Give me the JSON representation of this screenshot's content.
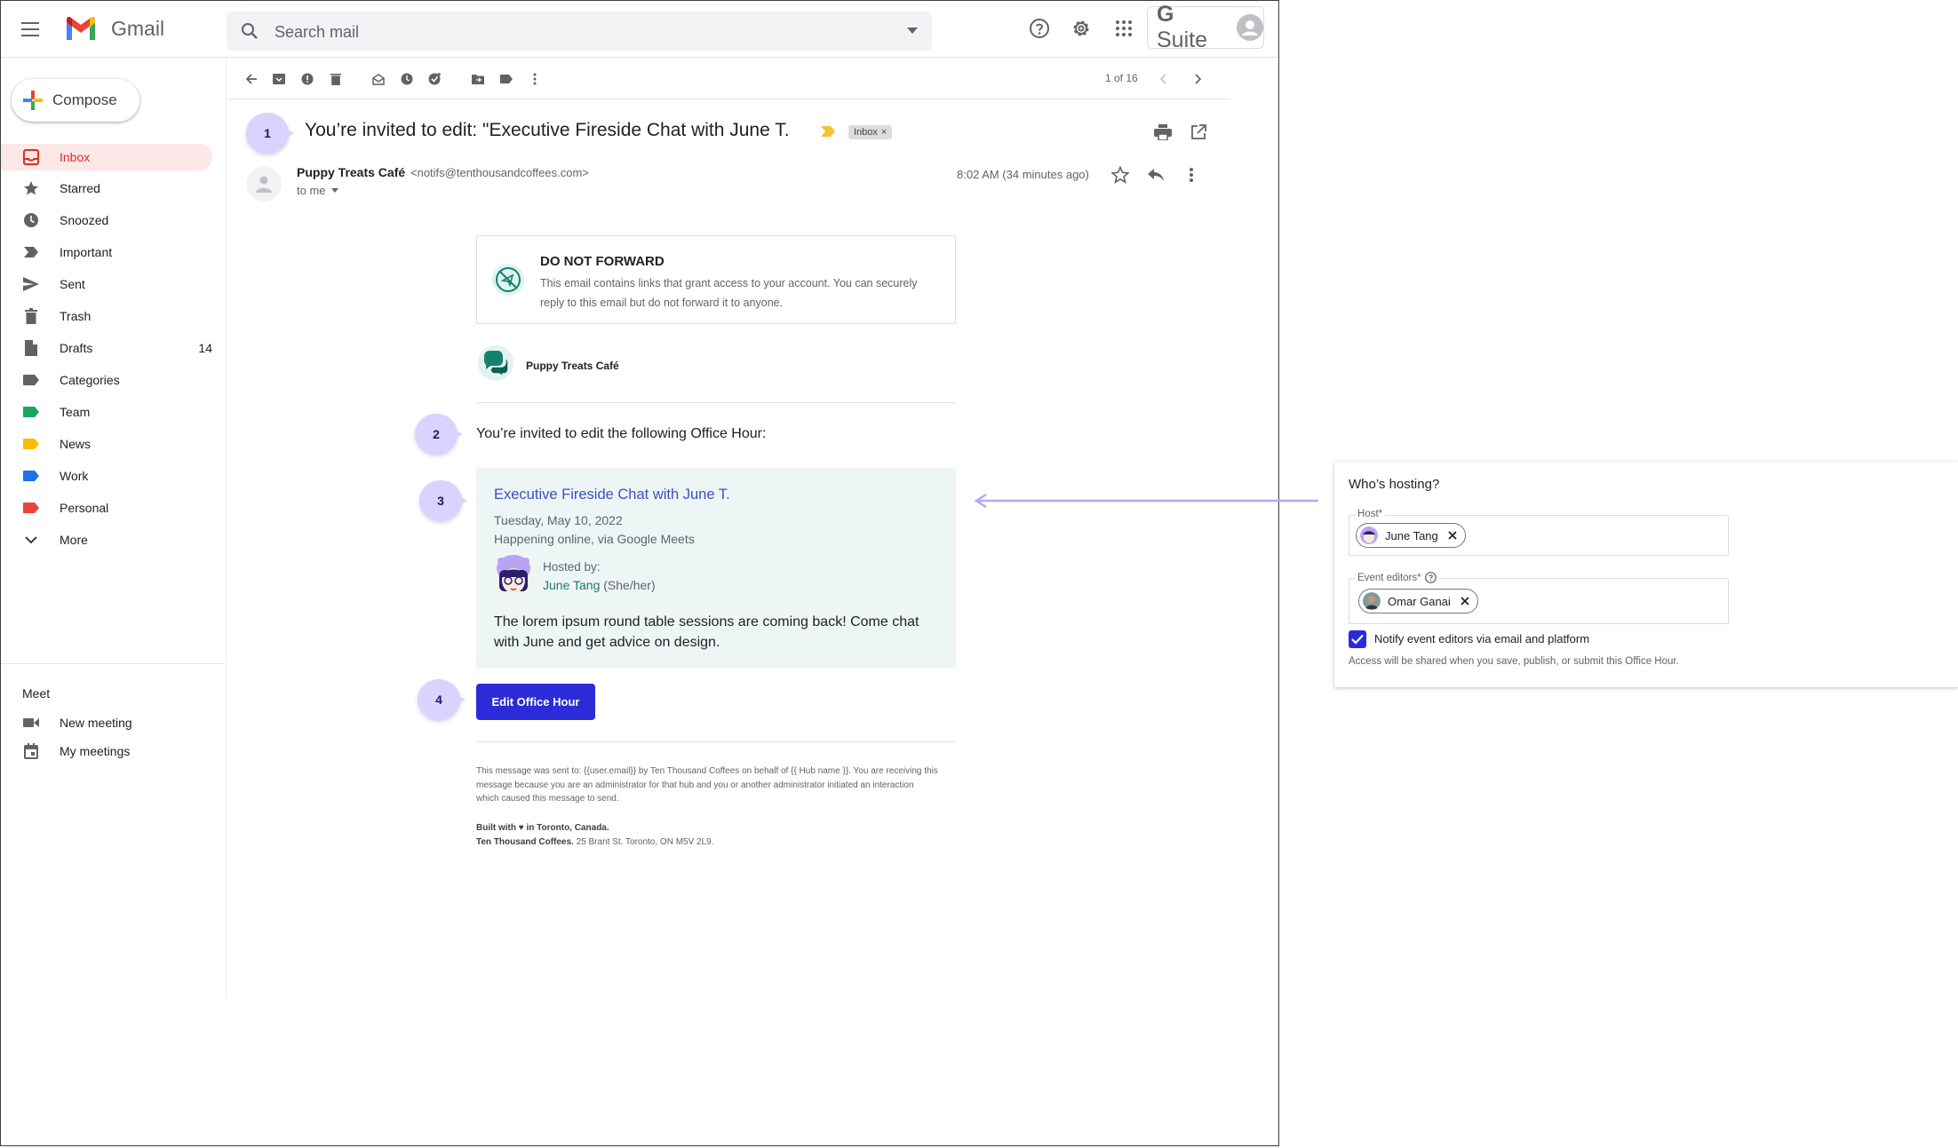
{
  "header": {
    "app_name": "Gmail",
    "search_placeholder": "Search mail",
    "gsuite_label": "Suite",
    "gsuite_g": "G"
  },
  "sidebar": {
    "compose_label": "Compose",
    "items": [
      {
        "label": "Inbox",
        "icon": "inbox-icon",
        "active": true
      },
      {
        "label": "Starred",
        "icon": "star-icon"
      },
      {
        "label": "Snoozed",
        "icon": "clock-icon"
      },
      {
        "label": "Important",
        "icon": "important-icon"
      },
      {
        "label": "Sent",
        "icon": "send-icon"
      },
      {
        "label": "Trash",
        "icon": "trash-icon"
      },
      {
        "label": "Drafts",
        "icon": "draft-icon",
        "count": "14"
      },
      {
        "label": "Categories",
        "icon": "label-icon",
        "color": "#5f6368"
      },
      {
        "label": "Team",
        "icon": "label-icon",
        "color": "#16a765"
      },
      {
        "label": "News",
        "icon": "label-icon",
        "color": "#fbbc04"
      },
      {
        "label": "Work",
        "icon": "label-icon",
        "color": "#1a73e8"
      },
      {
        "label": "Personal",
        "icon": "label-icon",
        "color": "#e8453c"
      },
      {
        "label": "More",
        "icon": "chevron-down-icon"
      }
    ],
    "meet_heading": "Meet",
    "meet_items": [
      {
        "label": "New meeting",
        "icon": "video-icon"
      },
      {
        "label": "My meetings",
        "icon": "calendar-icon"
      }
    ]
  },
  "toolbar": {
    "pager": "1 of 16"
  },
  "message": {
    "callouts": [
      "1",
      "2",
      "3",
      "4"
    ],
    "subject": "You’re invited to edit: \"Executive Fireside Chat with June T.",
    "inbox_chip": "Inbox",
    "sender_name": "Puppy Treats Café",
    "sender_email": "<notifs@tenthousandcoffees.com>",
    "to_me": "to me",
    "timestamp": "8:02 AM (34 minutes ago)"
  },
  "email_body": {
    "dnf_title": "DO NOT FORWARD",
    "dnf_text": "This email contains links that grant access to your account. You can securely reply to this email but do not forward it to anyone.",
    "brand_name": "Puppy Treats Café",
    "invite_text": "You’re invited to edit the following Office Hour:",
    "event": {
      "title": "Executive Fireside Chat with June T.",
      "date": "Tuesday, May 10, 2022",
      "location": "Happening online, via Google Meets",
      "hosted_by_label": "Hosted by:",
      "host_name": "June Tang",
      "host_pronouns": " (She/her)",
      "description": "The lorem ipsum round table sessions are coming back! Come chat with June and get advice on design."
    },
    "cta_label": "Edit Office Hour",
    "footer_text": "This message was sent to: {{user.email}} by Ten Thousand Coffees on behalf of {{ Hub name }}. You are receiving this message because you are an administrator for that hub and you or another administrator initiated an interaction which caused this message to send.",
    "built_with_prefix": "Built with",
    "built_with_suffix": "in Toronto, Canada.",
    "company_name": "Ten Thousand Coffees.",
    "company_address": "25 Brant St. Toronto, ON M5V 2L9."
  },
  "panel": {
    "title": "Who’s hosting?",
    "host_label": "Host*",
    "host_chip": "June Tang",
    "editors_label": "Event editors*",
    "editor_chip": "Omar Ganai",
    "notify_label": "Notify event editors via email and platform",
    "notify_checked": true,
    "access_note": "Access will be shared when you save, publish, or submit this Office Hour."
  },
  "colors": {
    "accent_blue": "#2b2bd9",
    "callout_purple": "#d9d3ff",
    "event_card_bg": "#eef6f5",
    "inbox_active_bg": "#fce8e6",
    "arrow": "#b3a9f2"
  }
}
